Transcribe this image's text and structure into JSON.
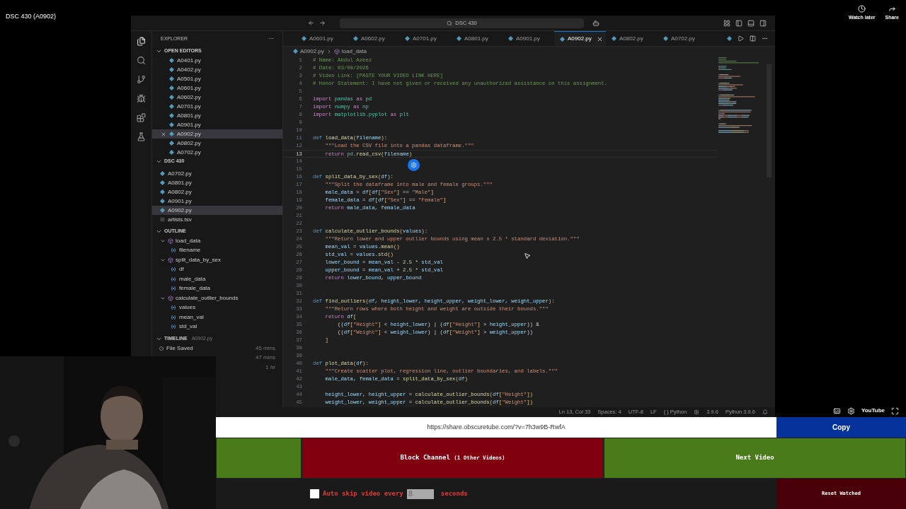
{
  "video_title": "DSC 430 (A0902)",
  "top_actions": [
    {
      "label": "Watch later",
      "kind": "clock"
    },
    {
      "label": "Share",
      "kind": "share"
    }
  ],
  "editor": {
    "command_center": "DSC 430",
    "sidebar": {
      "title": "EXPLORER",
      "more": "···",
      "open_editors": {
        "title": "OPEN EDITORS",
        "expanded": true,
        "items": [
          {
            "name": "A0401.py",
            "selected": false
          },
          {
            "name": "A0402.py",
            "selected": false
          },
          {
            "name": "A0501.py",
            "selected": false
          },
          {
            "name": "A0601.py",
            "selected": false
          },
          {
            "name": "A0602.py",
            "selected": false
          },
          {
            "name": "A0701.py",
            "selected": false
          },
          {
            "name": "A0801.py",
            "selected": false
          },
          {
            "name": "A0901.py",
            "selected": false
          },
          {
            "name": "A0902.py",
            "selected": true
          },
          {
            "name": "A0802.py",
            "selected": false
          },
          {
            "name": "A0702.py",
            "selected": false
          }
        ]
      },
      "folder": {
        "title": "DSC 430",
        "expanded": true,
        "items": [
          {
            "name": "A0702.py",
            "kind": "python",
            "selected": false
          },
          {
            "name": "A0801.py",
            "kind": "python",
            "selected": false
          },
          {
            "name": "A0802.py",
            "kind": "python",
            "selected": false
          },
          {
            "name": "A0901.py",
            "kind": "python",
            "selected": false
          },
          {
            "name": "A0902.py",
            "kind": "python",
            "selected": true
          },
          {
            "name": "artists.tsv",
            "kind": "text",
            "selected": false
          }
        ]
      },
      "outline": {
        "title": "OUTLINE",
        "expanded": true,
        "items": [
          {
            "name": "load_data",
            "kind": "function",
            "expanded": true,
            "children": [
              {
                "name": "filename",
                "kind": "variable"
              }
            ]
          },
          {
            "name": "split_data_by_sex",
            "kind": "function",
            "expanded": true,
            "children": [
              {
                "name": "df",
                "kind": "variable"
              },
              {
                "name": "male_data",
                "kind": "variable"
              },
              {
                "name": "female_data",
                "kind": "variable"
              }
            ]
          },
          {
            "name": "calculate_outlier_bounds",
            "kind": "function",
            "expanded": true,
            "children": [
              {
                "name": "values",
                "kind": "variable"
              },
              {
                "name": "mean_val",
                "kind": "variable"
              },
              {
                "name": "std_val",
                "kind": "variable"
              }
            ]
          }
        ]
      },
      "timeline": {
        "title": "TIMELINE",
        "file": "A0902.py",
        "expanded": true,
        "entries": [
          {
            "label": "File Saved",
            "time": "45 mins"
          },
          {
            "time": "47 mins"
          },
          {
            "time": "1 hr"
          }
        ]
      }
    },
    "tabs": [
      {
        "label": "A0601.py",
        "selected": false
      },
      {
        "label": "A0602.py",
        "selected": false
      },
      {
        "label": "A0701.py",
        "selected": false
      },
      {
        "label": "A0801.py",
        "selected": false
      },
      {
        "label": "A0901.py",
        "selected": false
      },
      {
        "label": "A0902.py",
        "selected": true
      },
      {
        "label": "A0802.py",
        "selected": false
      },
      {
        "label": "A0702.py",
        "selected": false
      }
    ],
    "breadcrumb": [
      {
        "label": "A0902.py",
        "kind": "file"
      },
      {
        "label": "load_data",
        "kind": "function"
      }
    ],
    "lines": [
      {
        "number": "1",
        "current": false,
        "tokens": [
          {
            "kind": "comment",
            "text": "# Name: Abdul Azeez"
          }
        ]
      },
      {
        "number": "2",
        "current": false,
        "tokens": [
          {
            "kind": "comment",
            "text": "# Date: 03/08/2026"
          }
        ]
      },
      {
        "number": "3",
        "current": false,
        "tokens": [
          {
            "kind": "comment",
            "text": "# Video Link: [PASTE YOUR VIDEO LINK HERE]"
          }
        ]
      },
      {
        "number": "4",
        "current": false,
        "tokens": [
          {
            "kind": "comment",
            "text": "# Honor Statement: I have not given or received any unauthorized assistance on this assignment."
          }
        ]
      },
      {
        "number": "5",
        "current": false
      },
      {
        "number": "6",
        "current": false,
        "tokens": [
          {
            "kind": "keyword",
            "text": "import"
          },
          {
            "kind": "module",
            "text": " pandas "
          },
          {
            "kind": "keyword",
            "text": "as"
          },
          {
            "kind": "module",
            "text": " pd"
          }
        ]
      },
      {
        "number": "7",
        "current": false,
        "tokens": [
          {
            "kind": "keyword",
            "text": "import"
          },
          {
            "kind": "module",
            "text": " numpy "
          },
          {
            "kind": "keyword",
            "text": "as"
          },
          {
            "kind": "module",
            "text": " np"
          }
        ]
      },
      {
        "number": "8",
        "current": false,
        "tokens": [
          {
            "kind": "keyword",
            "text": "import"
          },
          {
            "kind": "module",
            "text": " matplotlib.pyplot "
          },
          {
            "kind": "keyword",
            "text": "as"
          },
          {
            "kind": "module",
            "text": " plt"
          }
        ]
      },
      {
        "number": "9",
        "current": false
      },
      {
        "number": "10",
        "current": false
      },
      {
        "number": "11",
        "current": false,
        "tokens": [
          {
            "kind": "def",
            "text": "def "
          },
          {
            "kind": "func",
            "text": "load_data"
          },
          {
            "kind": "bracket",
            "text": "("
          },
          {
            "kind": "var",
            "text": "filename"
          },
          {
            "kind": "bracket",
            "text": ")"
          },
          {
            "kind": "plain",
            "text": ":"
          }
        ]
      },
      {
        "number": "12",
        "current": false,
        "tokens": [
          {
            "kind": "str",
            "text": "    \"\"\"Load the CSV file into a pandas dataframe.\"\"\""
          }
        ]
      },
      {
        "number": "13",
        "current": true,
        "tokens": [
          {
            "kind": "keyword",
            "text": "    return"
          },
          {
            "kind": "module",
            "text": " pd"
          },
          {
            "kind": "plain",
            "text": "."
          },
          {
            "kind": "func",
            "text": "read_csv"
          },
          {
            "kind": "bracket",
            "text": "("
          },
          {
            "kind": "var",
            "text": "filename"
          },
          {
            "kind": "bracket",
            "text": ")"
          }
        ]
      },
      {
        "number": "14",
        "current": false
      },
      {
        "number": "15",
        "current": false
      },
      {
        "number": "16",
        "current": false,
        "tokens": [
          {
            "kind": "def",
            "text": "def "
          },
          {
            "kind": "func",
            "text": "split_data_by_sex"
          },
          {
            "kind": "bracket",
            "text": "("
          },
          {
            "kind": "var",
            "text": "df"
          },
          {
            "kind": "bracket",
            "text": ")"
          },
          {
            "kind": "plain",
            "text": ":"
          }
        ]
      },
      {
        "number": "17",
        "current": false,
        "tokens": [
          {
            "kind": "str",
            "text": "    \"\"\"Split the dataframe into male and female groups.\"\"\""
          }
        ]
      },
      {
        "number": "18",
        "current": false,
        "tokens": [
          {
            "kind": "var",
            "text": "    male_data"
          },
          {
            "kind": "plain",
            "text": " = "
          },
          {
            "kind": "var",
            "text": "df"
          },
          {
            "kind": "bracket",
            "text": "["
          },
          {
            "kind": "var",
            "text": "df"
          },
          {
            "kind": "bracket",
            "text": "["
          },
          {
            "kind": "str",
            "text": "\"Sex\""
          },
          {
            "kind": "bracket",
            "text": "]"
          },
          {
            "kind": "plain",
            "text": " == "
          },
          {
            "kind": "str",
            "text": "\"Male\""
          },
          {
            "kind": "bracket",
            "text": "]"
          }
        ]
      },
      {
        "number": "19",
        "current": false,
        "tokens": [
          {
            "kind": "var",
            "text": "    female_data"
          },
          {
            "kind": "plain",
            "text": " = "
          },
          {
            "kind": "var",
            "text": "df"
          },
          {
            "kind": "bracket",
            "text": "["
          },
          {
            "kind": "var",
            "text": "df"
          },
          {
            "kind": "bracket",
            "text": "["
          },
          {
            "kind": "str",
            "text": "\"Sex\""
          },
          {
            "kind": "bracket",
            "text": "]"
          },
          {
            "kind": "plain",
            "text": " == "
          },
          {
            "kind": "str",
            "text": "\"Female\""
          },
          {
            "kind": "bracket",
            "text": "]"
          }
        ]
      },
      {
        "number": "20",
        "current": false,
        "tokens": [
          {
            "kind": "keyword",
            "text": "    return"
          },
          {
            "kind": "var",
            "text": " male_data"
          },
          {
            "kind": "plain",
            "text": ", "
          },
          {
            "kind": "var",
            "text": "female_data"
          }
        ]
      },
      {
        "number": "21",
        "current": false
      },
      {
        "number": "22",
        "current": false
      },
      {
        "number": "23",
        "current": false,
        "tokens": [
          {
            "kind": "def",
            "text": "def "
          },
          {
            "kind": "func",
            "text": "calculate_outlier_bounds"
          },
          {
            "kind": "bracket",
            "text": "("
          },
          {
            "kind": "var",
            "text": "values"
          },
          {
            "kind": "bracket",
            "text": ")"
          },
          {
            "kind": "plain",
            "text": ":"
          }
        ]
      },
      {
        "number": "24",
        "current": false,
        "tokens": [
          {
            "kind": "str",
            "text": "    \"\"\"Return lower and upper outlier bounds using mean ± 2.5 * standard deviation.\"\"\""
          }
        ]
      },
      {
        "number": "25",
        "current": false,
        "tokens": [
          {
            "kind": "var",
            "text": "    mean_val"
          },
          {
            "kind": "plain",
            "text": " = "
          },
          {
            "kind": "var",
            "text": "values"
          },
          {
            "kind": "plain",
            "text": "."
          },
          {
            "kind": "func",
            "text": "mean"
          },
          {
            "kind": "bracket",
            "text": "()"
          }
        ]
      },
      {
        "number": "26",
        "current": false,
        "tokens": [
          {
            "kind": "var",
            "text": "    std_val"
          },
          {
            "kind": "plain",
            "text": " = "
          },
          {
            "kind": "var",
            "text": "values"
          },
          {
            "kind": "plain",
            "text": "."
          },
          {
            "kind": "func",
            "text": "std"
          },
          {
            "kind": "bracket",
            "text": "()"
          }
        ]
      },
      {
        "number": "27",
        "current": false,
        "tokens": [
          {
            "kind": "var",
            "text": "    lower_bound"
          },
          {
            "kind": "plain",
            "text": " = "
          },
          {
            "kind": "var",
            "text": "mean_val"
          },
          {
            "kind": "plain",
            "text": " - "
          },
          {
            "kind": "num",
            "text": "2.5"
          },
          {
            "kind": "plain",
            "text": " * "
          },
          {
            "kind": "var",
            "text": "std_val"
          }
        ]
      },
      {
        "number": "28",
        "current": false,
        "tokens": [
          {
            "kind": "var",
            "text": "    upper_bound"
          },
          {
            "kind": "plain",
            "text": " = "
          },
          {
            "kind": "var",
            "text": "mean_val"
          },
          {
            "kind": "plain",
            "text": " + "
          },
          {
            "kind": "num",
            "text": "2.5"
          },
          {
            "kind": "plain",
            "text": " * "
          },
          {
            "kind": "var",
            "text": "std_val"
          }
        ]
      },
      {
        "number": "29",
        "current": false,
        "tokens": [
          {
            "kind": "keyword",
            "text": "    return"
          },
          {
            "kind": "var",
            "text": " lower_bound"
          },
          {
            "kind": "plain",
            "text": ", "
          },
          {
            "kind": "var",
            "text": "upper_bound"
          }
        ]
      },
      {
        "number": "30",
        "current": false
      },
      {
        "number": "31",
        "current": false
      },
      {
        "number": "32",
        "current": false,
        "tokens": [
          {
            "kind": "def",
            "text": "def "
          },
          {
            "kind": "func",
            "text": "find_outliers"
          },
          {
            "kind": "bracket",
            "text": "("
          },
          {
            "kind": "var",
            "text": "df, height_lower, height_upper, weight_lower, weight_upper"
          },
          {
            "kind": "bracket",
            "text": ")"
          },
          {
            "kind": "plain",
            "text": ":"
          }
        ]
      },
      {
        "number": "33",
        "current": false,
        "tokens": [
          {
            "kind": "str",
            "text": "    \"\"\"Return rows where both height and weight are outside their bounds.\"\"\""
          }
        ]
      },
      {
        "number": "34",
        "current": false,
        "tokens": [
          {
            "kind": "keyword",
            "text": "    return"
          },
          {
            "kind": "var",
            "text": " df"
          },
          {
            "kind": "bracket",
            "text": "["
          }
        ]
      },
      {
        "number": "35",
        "current": false,
        "tokens": [
          {
            "kind": "plain",
            "text": "        (("
          },
          {
            "kind": "var",
            "text": "df"
          },
          {
            "kind": "bracket",
            "text": "["
          },
          {
            "kind": "str",
            "text": "\"Height\""
          },
          {
            "kind": "bracket",
            "text": "]"
          },
          {
            "kind": "plain",
            "text": " < "
          },
          {
            "kind": "var",
            "text": "height_lower"
          },
          {
            "kind": "plain",
            "text": ") | ("
          },
          {
            "kind": "var",
            "text": "df"
          },
          {
            "kind": "bracket",
            "text": "["
          },
          {
            "kind": "str",
            "text": "\"Height\""
          },
          {
            "kind": "bracket",
            "text": "]"
          },
          {
            "kind": "plain",
            "text": " > "
          },
          {
            "kind": "var",
            "text": "height_upper"
          },
          {
            "kind": "plain",
            "text": ")) &"
          }
        ]
      },
      {
        "number": "36",
        "current": false,
        "tokens": [
          {
            "kind": "plain",
            "text": "        (("
          },
          {
            "kind": "var",
            "text": "df"
          },
          {
            "kind": "bracket",
            "text": "["
          },
          {
            "kind": "str",
            "text": "\"Weight\""
          },
          {
            "kind": "bracket",
            "text": "]"
          },
          {
            "kind": "plain",
            "text": " < "
          },
          {
            "kind": "var",
            "text": "weight_lower"
          },
          {
            "kind": "plain",
            "text": ") | ("
          },
          {
            "kind": "var",
            "text": "df"
          },
          {
            "kind": "bracket",
            "text": "["
          },
          {
            "kind": "str",
            "text": "\"Weight\""
          },
          {
            "kind": "bracket",
            "text": "]"
          },
          {
            "kind": "plain",
            "text": " > "
          },
          {
            "kind": "var",
            "text": "weight_upper"
          },
          {
            "kind": "plain",
            "text": "))"
          }
        ]
      },
      {
        "number": "37",
        "current": false,
        "tokens": [
          {
            "kind": "bracket",
            "text": "    ]"
          }
        ]
      },
      {
        "number": "38",
        "current": false
      },
      {
        "number": "39",
        "current": false
      },
      {
        "number": "40",
        "current": false,
        "tokens": [
          {
            "kind": "def",
            "text": "def "
          },
          {
            "kind": "func",
            "text": "plot_data"
          },
          {
            "kind": "bracket",
            "text": "("
          },
          {
            "kind": "var",
            "text": "df"
          },
          {
            "kind": "bracket",
            "text": ")"
          },
          {
            "kind": "plain",
            "text": ":"
          }
        ]
      },
      {
        "number": "41",
        "current": false,
        "tokens": [
          {
            "kind": "str",
            "text": "    \"\"\"Create scatter plot, regression line, outlier boundaries, and labels.\"\"\""
          }
        ]
      },
      {
        "number": "42",
        "current": false,
        "tokens": [
          {
            "kind": "var",
            "text": "    male_data, female_data"
          },
          {
            "kind": "plain",
            "text": " = "
          },
          {
            "kind": "func",
            "text": "split_data_by_sex"
          },
          {
            "kind": "bracket",
            "text": "("
          },
          {
            "kind": "var",
            "text": "df"
          },
          {
            "kind": "bracket",
            "text": ")"
          }
        ]
      },
      {
        "number": "43",
        "current": false
      },
      {
        "number": "44",
        "current": false,
        "tokens": [
          {
            "kind": "var",
            "text": "    height_lower, height_upper"
          },
          {
            "kind": "plain",
            "text": " = "
          },
          {
            "kind": "func",
            "text": "calculate_outlier_bounds"
          },
          {
            "kind": "bracket",
            "text": "("
          },
          {
            "kind": "var",
            "text": "df"
          },
          {
            "kind": "bracket",
            "text": "["
          },
          {
            "kind": "str",
            "text": "\"Height\""
          },
          {
            "kind": "bracket",
            "text": "])"
          }
        ]
      },
      {
        "number": "45",
        "current": false,
        "tokens": [
          {
            "kind": "var",
            "text": "    weight_lower, weight_upper"
          },
          {
            "kind": "plain",
            "text": " = "
          },
          {
            "kind": "func",
            "text": "calculate_outlier_bounds"
          },
          {
            "kind": "bracket",
            "text": "("
          },
          {
            "kind": "var",
            "text": "df"
          },
          {
            "kind": "bracket",
            "text": "["
          },
          {
            "kind": "str",
            "text": "\"Weight\""
          },
          {
            "kind": "bracket",
            "text": "])"
          }
        ]
      }
    ],
    "status_bar": [
      "Ln 13, Col 33",
      "Spaces: 4",
      "UTF-8",
      "LF",
      "{ } Python",
      "3.9.6",
      "Python 3.9.6"
    ]
  },
  "player_controls": {
    "logo": "YouTube"
  },
  "share": {
    "url": "https://share.obscuretube.com/?v=7h3w9B-RwfA",
    "button": "Copy"
  },
  "actions": {
    "block": "Block Channel",
    "block_note": "(1 Other Videos)",
    "next": "Next Video"
  },
  "auto_skip": {
    "checked": false,
    "label": "Auto skip video every",
    "value": "8",
    "unit": "seconds"
  },
  "reset": "Reset Watched"
}
